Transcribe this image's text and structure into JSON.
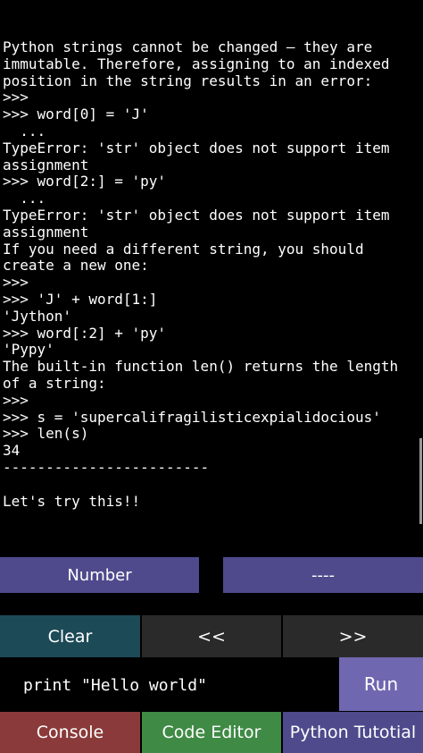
{
  "console": {
    "output": "Python strings cannot be changed — they are\nimmutable. Therefore, assigning to an indexed\nposition in the string results in an error:\n>>>\n>>> word[0] = 'J'\n  ...\nTypeError: 'str' object does not support item\nassignment\n>>> word[2:] = 'py'\n  ...\nTypeError: 'str' object does not support item\nassignment\nIf you need a different string, you should\ncreate a new one:\n>>>\n>>> 'J' + word[1:]\n'Jython'\n>>> word[:2] + 'py'\n'Pypy'\nThe built-in function len() returns the length\nof a string:\n>>>\n>>> s = 'supercalifragilisticexpialidocious'\n>>> len(s)\n34\n------------------------\n\nLet's try this!!"
  },
  "buttons": {
    "number": "Number",
    "dashes": "----",
    "clear": "Clear",
    "prev": "<<",
    "next": ">>",
    "run": "Run"
  },
  "input": {
    "value": "print \"Hello world\""
  },
  "tabs": [
    "Console",
    "Code Editor",
    "Python Tutotial"
  ],
  "colors": {
    "background": "#000000",
    "purple_button": "#4e4a8c",
    "run_button": "#6f67b0",
    "clear_button": "#1d4a57",
    "nav_button": "#2a2a2a",
    "console_tab": "#8a3a3a",
    "code_editor_tab": "#3f8a45",
    "tutorial_tab": "#4e4a8c"
  }
}
